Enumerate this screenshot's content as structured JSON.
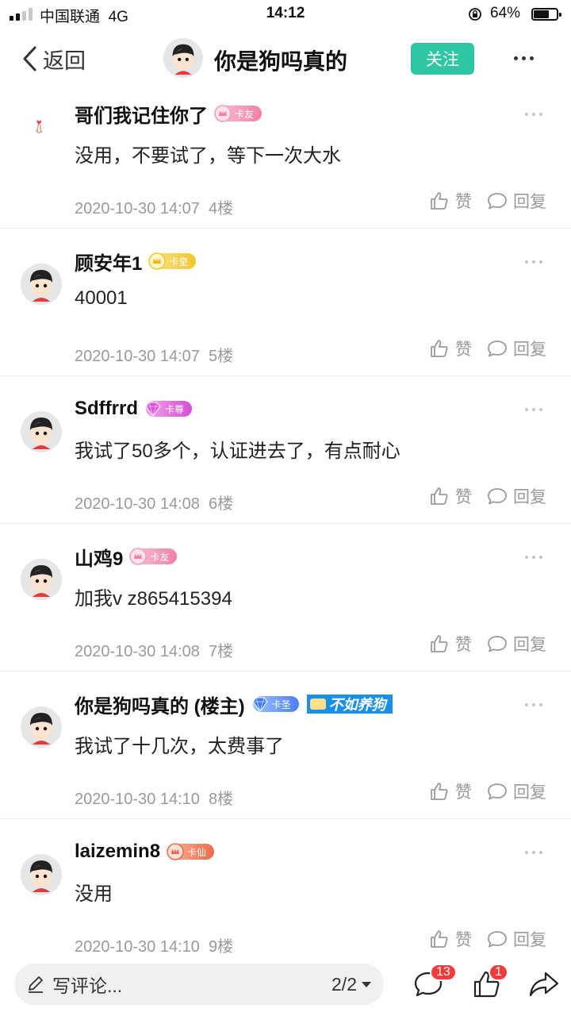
{
  "status_bar": {
    "carrier": "中国联通",
    "network": "4G",
    "time": "14:12",
    "battery_percent": "64%"
  },
  "header": {
    "back_label": "返回",
    "title": "你是狗吗真的",
    "follow_label": "关注"
  },
  "comments": [
    {
      "username": "哥们我记住你了",
      "badge": "卡友",
      "badge_color": "#f37fa6",
      "text": "没用，不要试了，等下一次大水",
      "timestamp": "2020-10-30 14:07",
      "floor": "4楼",
      "like_label": "赞",
      "reply_label": "回复",
      "avatar": "hand-heart-icon"
    },
    {
      "username": "顾安年1",
      "badge": "卡皇",
      "badge_color": "#f1c72d",
      "text": "40001",
      "timestamp": "2020-10-30 14:07",
      "floor": "5楼",
      "like_label": "赞",
      "reply_label": "回复",
      "avatar": "cartoon-avatar"
    },
    {
      "username": "Sdffrrd",
      "badge": "卡尊",
      "badge_color": "#d64fd0",
      "text": "我试了50多个，认证进去了，有点耐心",
      "timestamp": "2020-10-30 14:08",
      "floor": "6楼",
      "like_label": "赞",
      "reply_label": "回复",
      "avatar": "cartoon-avatar"
    },
    {
      "username": "山鸡9",
      "badge": "卡友",
      "badge_color": "#f37fa6",
      "text": "加我v  z865415394",
      "timestamp": "2020-10-30 14:08",
      "floor": "7楼",
      "like_label": "赞",
      "reply_label": "回复",
      "avatar": "cartoon-avatar"
    },
    {
      "username": "你是狗吗真的 (楼主)",
      "badge": "卡圣",
      "badge_color": "#4b7ff2",
      "extra_badge": "不如养狗",
      "text": "我试了十几次，太费事了",
      "timestamp": "2020-10-30 14:10",
      "floor": "8楼",
      "like_label": "赞",
      "reply_label": "回复",
      "avatar": "cartoon-avatar"
    },
    {
      "username": "laizemin8",
      "badge": "卡仙",
      "badge_color": "#ee6b4a",
      "text": "没用",
      "timestamp": "2020-10-30 14:10",
      "floor": "9楼",
      "like_label": "赞",
      "reply_label": "回复",
      "avatar": "cartoon-avatar"
    }
  ],
  "bottom_bar": {
    "input_placeholder": "写评论...",
    "page_indicator": "2/2",
    "comment_count": "13",
    "like_count": "1"
  }
}
